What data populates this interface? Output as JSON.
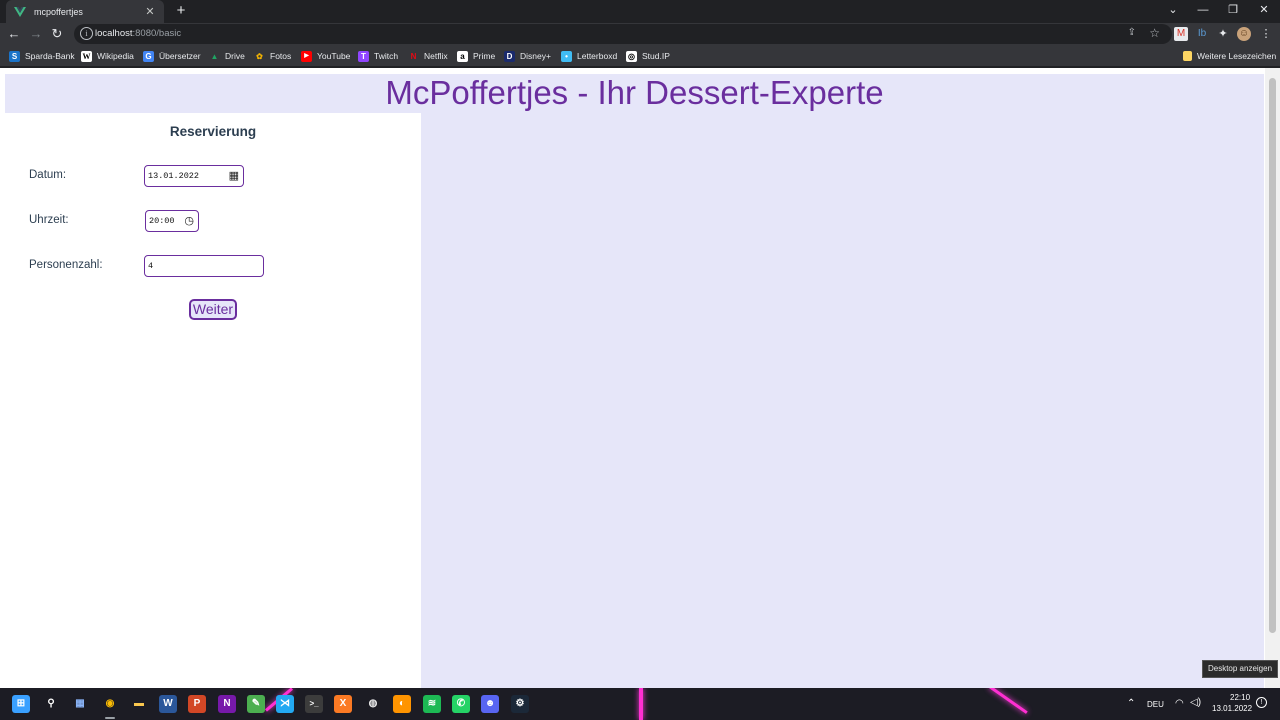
{
  "browser": {
    "tab": {
      "title": "mcpoffertjes",
      "close": "✕"
    },
    "new_tab": "+",
    "window_controls": {
      "tabsearch": "⌄",
      "minimize": "—",
      "restore": "❐",
      "close": "✕"
    },
    "url": {
      "host": "localhost",
      "path": ":8080/basic"
    },
    "bookmarks": [
      {
        "label": "Sparda-Bank",
        "icon": "S",
        "color": "#1a73c8"
      },
      {
        "label": "Wikipedia",
        "icon": "W",
        "color": "#ffffff"
      },
      {
        "label": "Übersetzer",
        "icon": "G",
        "color": "#4285f4"
      },
      {
        "label": "Drive",
        "icon": "▲",
        "color": "#1fa463"
      },
      {
        "label": "Fotos",
        "icon": "✿",
        "color": "#f4b400"
      },
      {
        "label": "YouTube",
        "icon": "▶",
        "color": "#ff0000"
      },
      {
        "label": "Twitch",
        "icon": "T",
        "color": "#9146ff"
      },
      {
        "label": "Netflix",
        "icon": "N",
        "color": "#e50914"
      },
      {
        "label": "Prime",
        "icon": "a",
        "color": "#ffffff"
      },
      {
        "label": "Disney+",
        "icon": "D",
        "color": "#1a2a6c"
      },
      {
        "label": "Letterboxd",
        "icon": "•",
        "color": "#40bcf4"
      },
      {
        "label": "Stud.IP",
        "icon": "◎",
        "color": "#ffffff"
      }
    ],
    "other_bookmarks": "Weitere Lesezeichen"
  },
  "page": {
    "title": "McPoffertjes - Ihr Dessert-Experte",
    "form": {
      "heading": "Reservierung",
      "date_label": "Datum:",
      "date_value": "13.01.2022",
      "time_label": "Uhrzeit:",
      "time_value": "20:00",
      "persons_label": "Personenzahl:",
      "persons_value": "4",
      "submit_label": "Weiter"
    }
  },
  "taskbar": {
    "apps": [
      {
        "name": "windows-start-icon",
        "glyph": "⊞",
        "color": "#3aa0ff"
      },
      {
        "name": "search-icon",
        "glyph": "⚲",
        "color": "#ffffff"
      },
      {
        "name": "photos-app-icon",
        "glyph": "▦",
        "color": "#8ab4f8"
      },
      {
        "name": "chrome-icon",
        "glyph": "◉",
        "color": "#fbbc04"
      },
      {
        "name": "file-explorer-icon",
        "glyph": "▬",
        "color": "#f9c74f"
      },
      {
        "name": "word-icon",
        "glyph": "W",
        "color": "#2b579a"
      },
      {
        "name": "powerpoint-icon",
        "glyph": "P",
        "color": "#d24726"
      },
      {
        "name": "onenote-icon",
        "glyph": "N",
        "color": "#7719aa"
      },
      {
        "name": "notepad-icon",
        "glyph": "✎",
        "color": "#4caf50"
      },
      {
        "name": "vscode-icon",
        "glyph": "⋊",
        "color": "#23a9f2"
      },
      {
        "name": "terminal-icon",
        "glyph": ">_",
        "color": "#3c3c3c"
      },
      {
        "name": "xampp-icon",
        "glyph": "X",
        "color": "#fb7a24"
      },
      {
        "name": "app-icon",
        "glyph": "◍",
        "color": "#e8e8e8"
      },
      {
        "name": "firefox-icon",
        "glyph": "◐",
        "color": "#ff9400"
      },
      {
        "name": "spotify-icon",
        "glyph": "≋",
        "color": "#1db954"
      },
      {
        "name": "whatsapp-icon",
        "glyph": "✆",
        "color": "#25d366"
      },
      {
        "name": "discord-icon",
        "glyph": "☻",
        "color": "#5865f2"
      },
      {
        "name": "steam-icon",
        "glyph": "⚙",
        "color": "#1b2838"
      }
    ],
    "language": "DEU",
    "time": "22:10",
    "date": "13.01.2022",
    "tooltip": "Desktop anzeigen"
  }
}
